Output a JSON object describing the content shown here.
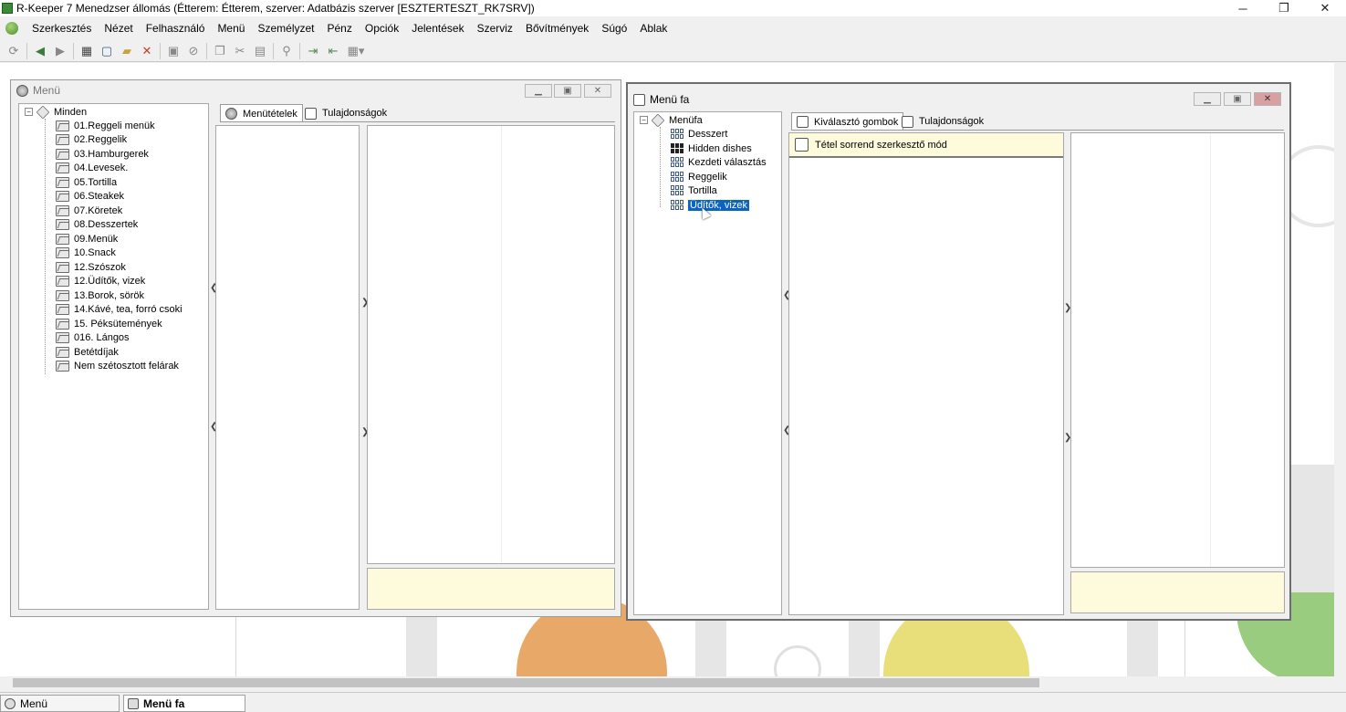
{
  "app": {
    "title": "R-Keeper 7 Menedzser állomás (Étterem: Étterem, szerver: Adatbázis szerver [ESZTERTESZT_RK7SRV])",
    "controls": [
      "─",
      "❐",
      "✕"
    ]
  },
  "menubar": [
    "Szerkesztés",
    "Nézet",
    "Felhasználó",
    "Menü",
    "Személyzet",
    "Pénz",
    "Opciók",
    "Jelentések",
    "Szerviz",
    "Bővítmények",
    "Súgó",
    "Ablak"
  ],
  "toolbar": {
    "icons": [
      "refresh-icon",
      "back-icon",
      "forward-icon",
      "grid-view-icon",
      "new-doc-icon",
      "open-folder-icon",
      "delete-icon",
      "save-icon",
      "cancel-icon",
      "copy-icon",
      "cut-icon",
      "paste-icon",
      "search-icon",
      "export-icon",
      "import-icon",
      "layout-icon"
    ]
  },
  "menu_window": {
    "title": "Menü",
    "tree": {
      "root": "Minden",
      "items": [
        "01.Reggeli menük",
        "02.Reggelik",
        "03.Hamburgerek",
        "04.Levesek.",
        "05.Tortilla",
        "06.Steakek",
        "07.Köretek",
        "08.Desszertek",
        "09.Menük",
        "10.Snack",
        "12.Szószok",
        "12.Üdítők, vizek",
        "13.Borok, sörök",
        "14.Kávé, tea, forró csoki",
        "15. Péksütemények",
        "016. Lángos",
        "Betétdíjak",
        "Nem szétosztott felárak"
      ]
    },
    "tabs": [
      "Menütételek",
      "Tulajdonságok"
    ]
  },
  "menufa_window": {
    "title": "Menü fa",
    "tree": {
      "root": "Menüfa",
      "items": [
        "Desszert",
        "Hidden dishes",
        "Kezdeti választás",
        "Reggelik",
        "Tortilla",
        "Üdítők, vizek"
      ],
      "selected": "Üdítők, vizek"
    },
    "tabs": [
      "Kiválasztó gombok",
      "Tulajdonságok"
    ],
    "mode_label": "Tétel sorrend szerkesztő mód"
  },
  "taskbar": [
    "Menü",
    "Menü fa"
  ],
  "colors": {
    "selection": "#0a64c8",
    "yellow_panel": "#fdfbdc",
    "bg_orange": "#e8a868",
    "bg_yellow": "#e9df7a",
    "bg_green": "#9acc80"
  }
}
